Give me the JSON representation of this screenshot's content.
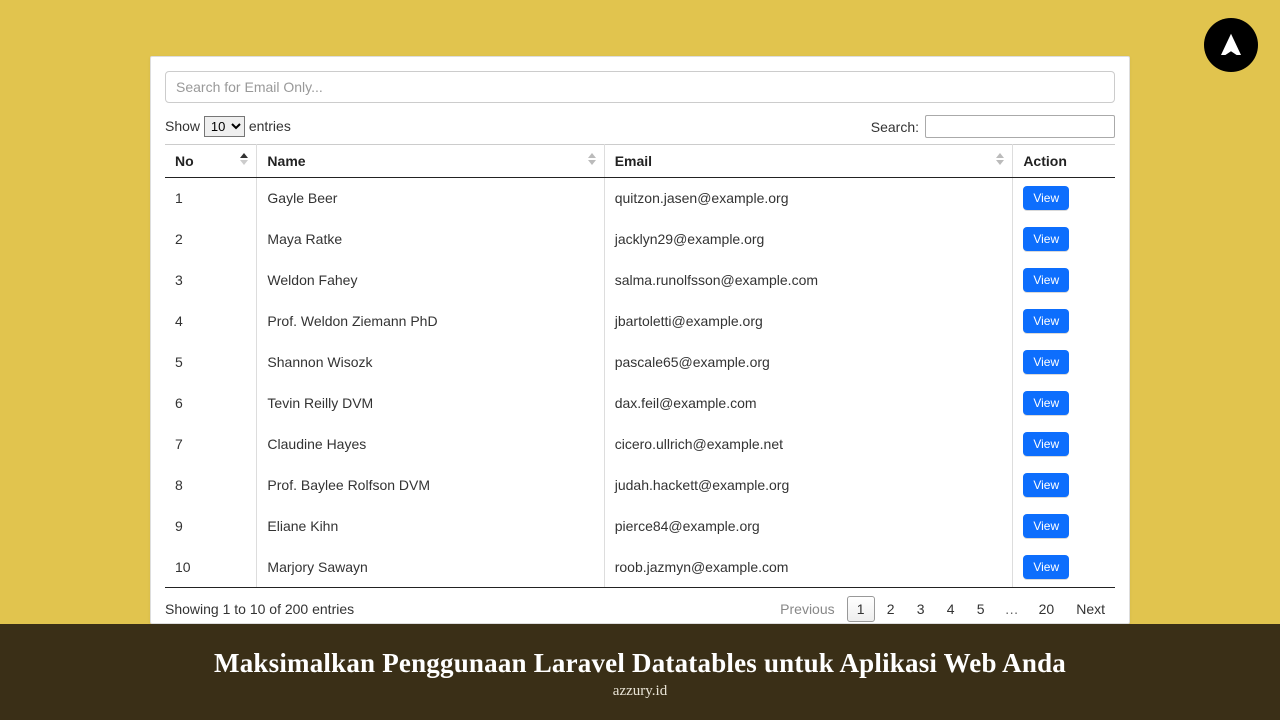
{
  "logo": {
    "name": "azzury-logo"
  },
  "search_email_placeholder": "Search for Email Only...",
  "length": {
    "prefix": "Show",
    "suffix": "entries",
    "selected": "10"
  },
  "search": {
    "label": "Search:"
  },
  "columns": [
    "No",
    "Name",
    "Email",
    "Action"
  ],
  "action_label": "View",
  "rows": [
    {
      "no": "1",
      "name": "Gayle Beer",
      "email": "quitzon.jasen@example.org"
    },
    {
      "no": "2",
      "name": "Maya Ratke",
      "email": "jacklyn29@example.org"
    },
    {
      "no": "3",
      "name": "Weldon Fahey",
      "email": "salma.runolfsson@example.com"
    },
    {
      "no": "4",
      "name": "Prof. Weldon Ziemann PhD",
      "email": "jbartoletti@example.org"
    },
    {
      "no": "5",
      "name": "Shannon Wisozk",
      "email": "pascale65@example.org"
    },
    {
      "no": "6",
      "name": "Tevin Reilly DVM",
      "email": "dax.feil@example.com"
    },
    {
      "no": "7",
      "name": "Claudine Hayes",
      "email": "cicero.ullrich@example.net"
    },
    {
      "no": "8",
      "name": "Prof. Baylee Rolfson DVM",
      "email": "judah.hackett@example.org"
    },
    {
      "no": "9",
      "name": "Eliane Kihn",
      "email": "pierce84@example.org"
    },
    {
      "no": "10",
      "name": "Marjory Sawayn",
      "email": "roob.jazmyn@example.com"
    }
  ],
  "info": "Showing 1 to 10 of 200 entries",
  "pagination": {
    "previous": "Previous",
    "next": "Next",
    "pages": [
      "1",
      "2",
      "3",
      "4",
      "5"
    ],
    "ellipsis": "…",
    "last": "20",
    "active": "1"
  },
  "banner": {
    "title": "Maksimalkan Penggunaan Laravel Datatables untuk Aplikasi Web Anda",
    "site": "azzury.id"
  }
}
